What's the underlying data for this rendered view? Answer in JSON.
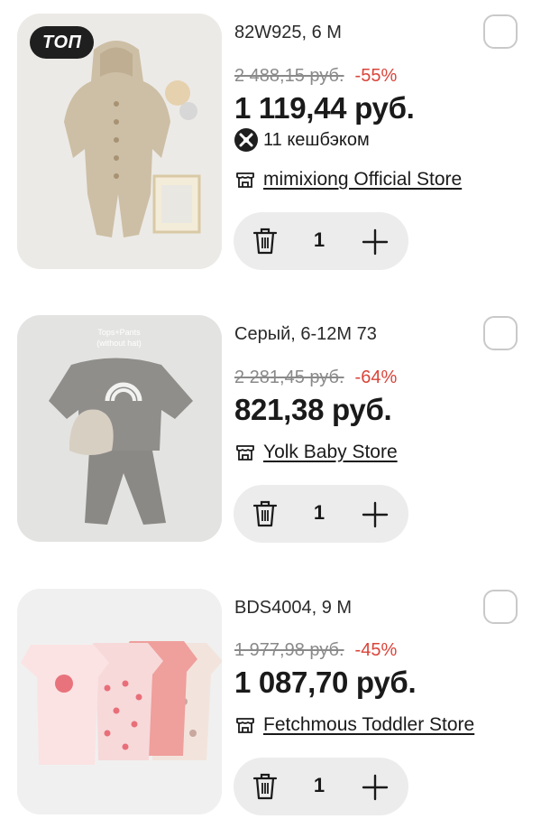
{
  "items": [
    {
      "badge": "ТОП",
      "variant": "82W925, 6 М",
      "old_price": "2 488,15 руб.",
      "discount": "-55%",
      "price": "1 119,44 руб.",
      "cashback": "11 кешбэком",
      "store": "mimixiong Official Store",
      "quantity": "1",
      "image": "knit-hooded-romper-beige"
    },
    {
      "variant": "Серый, 6-12М 73",
      "old_price": "2 281,45 руб.",
      "discount": "-64%",
      "price": "821,38 руб.",
      "store": "Yolk Baby Store",
      "quantity": "1",
      "image": "grey-rainbow-sweatshirt-set",
      "image_text": [
        "Tops+Pants",
        "(without hat)"
      ]
    },
    {
      "variant": "BDS4004, 9 М",
      "old_price": "1 977,98 руб.",
      "discount": "-45%",
      "price": "1 087,70 руб.",
      "store": "Fetchmous Toddler Store",
      "quantity": "1",
      "image": "pink-bodysuits-pack"
    }
  ],
  "colors": {
    "discount": "#d9443a",
    "stepper_bg": "#ececec",
    "badge_bg": "#1f1f1f"
  }
}
